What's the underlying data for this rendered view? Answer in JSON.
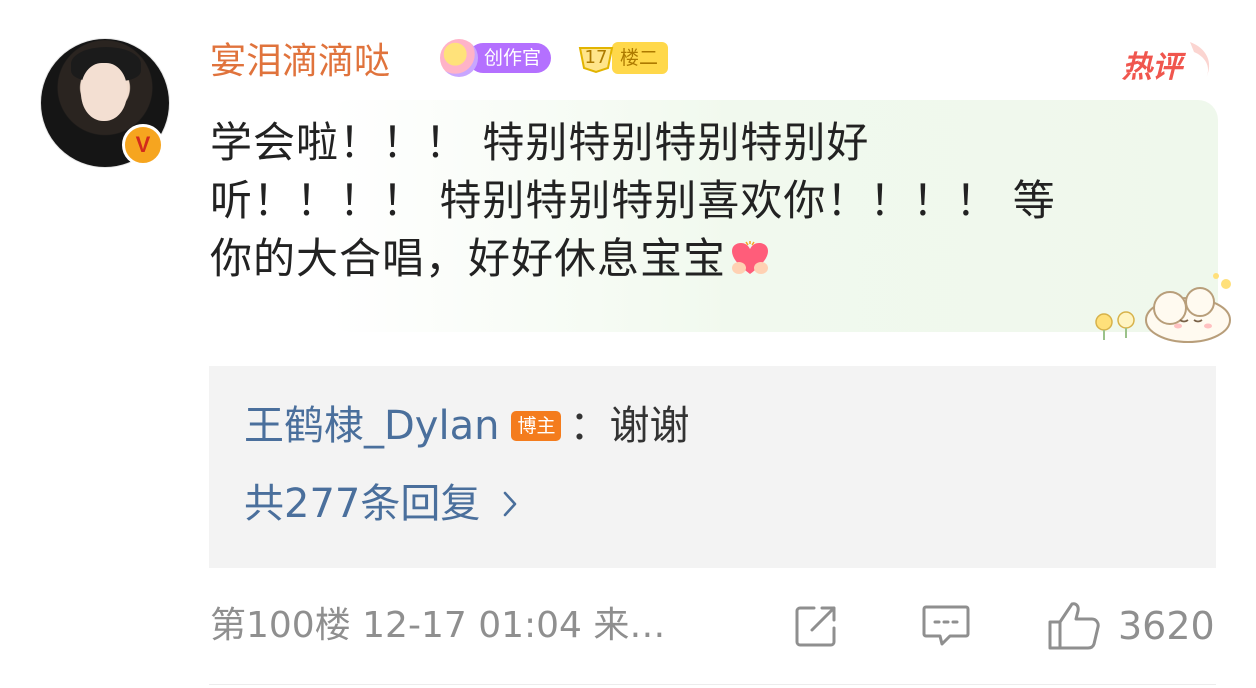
{
  "comment": {
    "username": "宴泪滴滴哒",
    "creator_badge": "创作官",
    "floor_level": "17",
    "floor_label": "楼二",
    "hot_tag": "热评",
    "body_line1": "学会啦！！！ 特别特别特别特别好",
    "body_line2": "听！！！！ 特别特别特别喜欢你！！！！ 等",
    "body_line3": "你的大合唱，好好休息宝宝",
    "reply": {
      "author": "王鹤棣_Dylan",
      "author_tag": "博主",
      "separator": "：",
      "text": "谢谢",
      "more_label": "共277条回复"
    },
    "footer": {
      "meta": "第100楼 12-17 01:04 来…",
      "like_count": "3620"
    }
  },
  "colors": {
    "username": "#e0733c",
    "link_blue": "#4a6f9c",
    "hot_red": "#f0564e",
    "creator_purple": "#b470ff",
    "floor_yellow": "#ffd84a",
    "author_tag_orange": "#f47c1d"
  },
  "icons": {
    "verified": "v-badge-icon",
    "share": "share-icon",
    "reply": "comment-icon",
    "like": "thumbs-up-icon",
    "emoji": "heart-hands-emoji",
    "sticker": "sleeping-sheep-sticker"
  }
}
